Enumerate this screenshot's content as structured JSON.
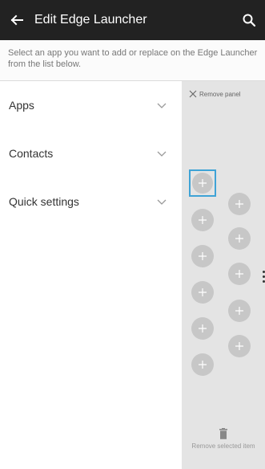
{
  "header": {
    "title": "Edit Edge Launcher",
    "back_icon": "arrow-left-icon",
    "search_icon": "search-icon",
    "bar_color": "#222222"
  },
  "instruction": "Select an app you want to add or replace on the Edge Launcher from the list below.",
  "categories": [
    {
      "label": "Apps",
      "icon": "chevron-down-icon"
    },
    {
      "label": "Contacts",
      "icon": "chevron-down-icon"
    },
    {
      "label": "Quick settings",
      "icon": "chevron-down-icon"
    }
  ],
  "panel": {
    "remove_panel_label": "Remove panel",
    "remove_selected_label": "Remove selected item",
    "selected_color": "#3fa3d6",
    "left_column_slots": 6,
    "right_column_slots": 5,
    "selected_slot": "left-column-1"
  }
}
